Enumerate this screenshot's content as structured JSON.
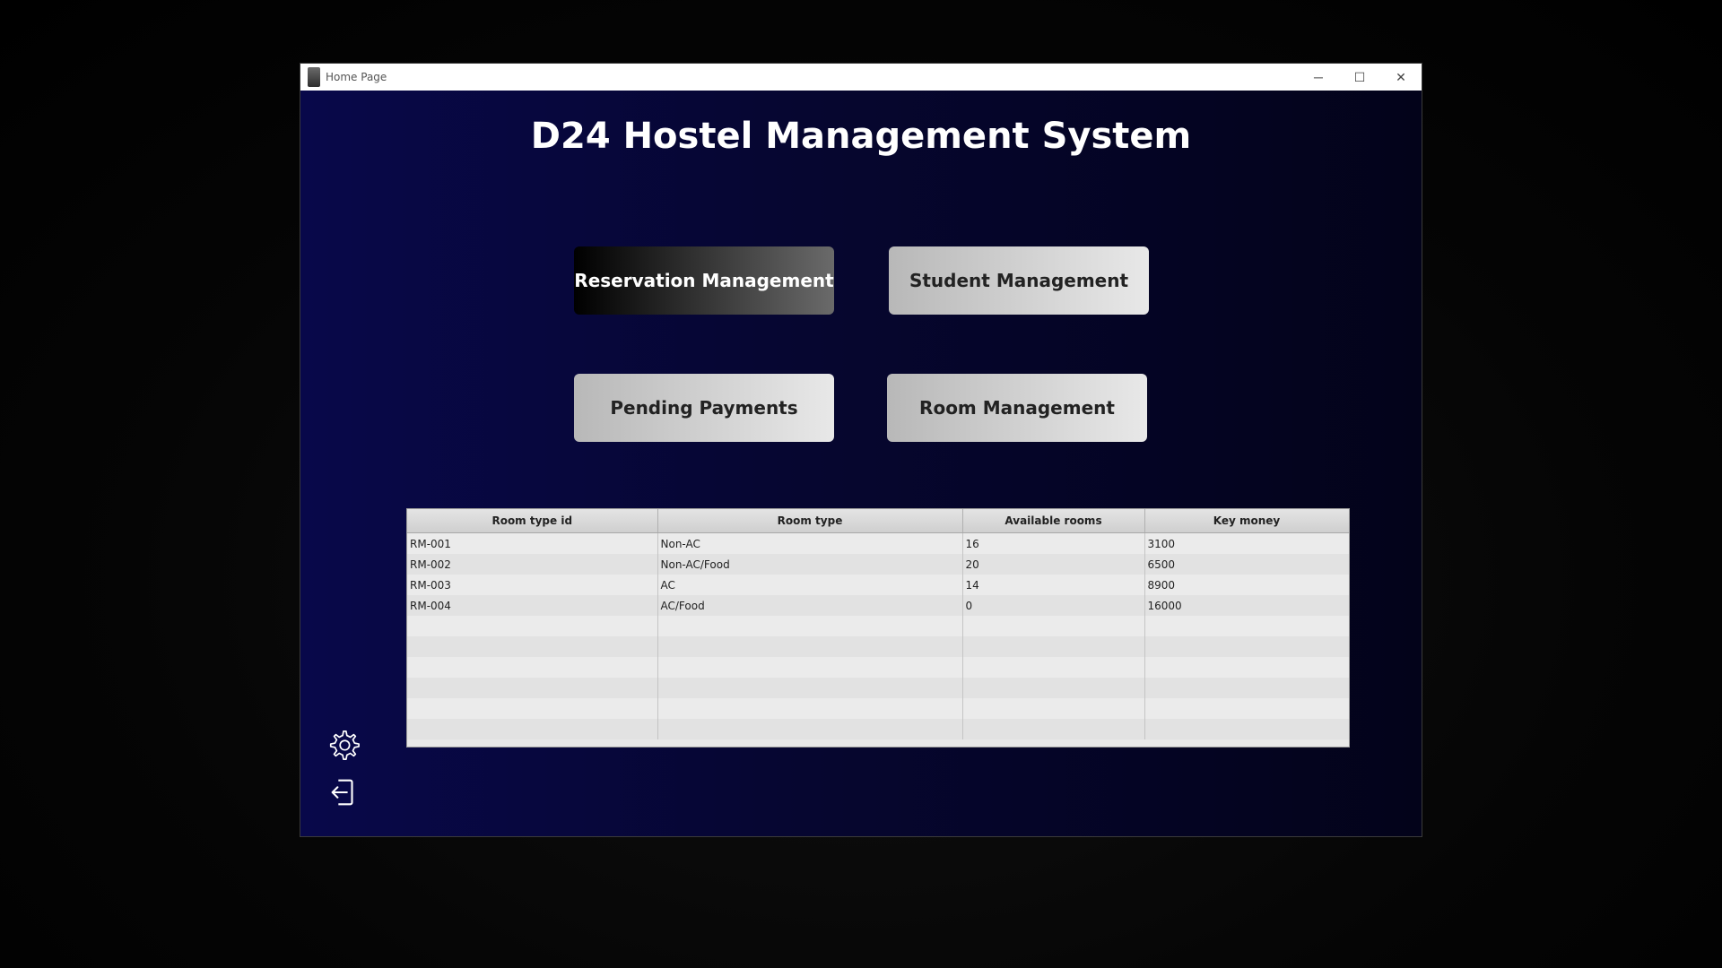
{
  "window": {
    "title": "Home Page",
    "controls": {
      "minimize": "─",
      "maximize": "☐",
      "close": "✕"
    }
  },
  "header": {
    "title": "D24 Hostel Management System"
  },
  "buttons": {
    "reservation": "Reservation Management",
    "student": "Student Management",
    "payments": "Pending Payments",
    "room": "Room Management"
  },
  "table": {
    "columns": [
      "Room type id",
      "Room type",
      "Available rooms",
      "Key money"
    ],
    "rows": [
      [
        "RM-001",
        "Non-AC",
        "16",
        "3100"
      ],
      [
        "RM-002",
        "Non-AC/Food",
        "20",
        "6500"
      ],
      [
        "RM-003",
        "AC",
        "14",
        "8900"
      ],
      [
        "RM-004",
        "AC/Food",
        "0",
        "16000"
      ]
    ]
  },
  "icons": {
    "settings": "gear-icon",
    "logout": "logout-icon"
  },
  "colors": {
    "background_left": "#08084a",
    "background_right": "#03031a",
    "title_text": "#ffffff"
  }
}
